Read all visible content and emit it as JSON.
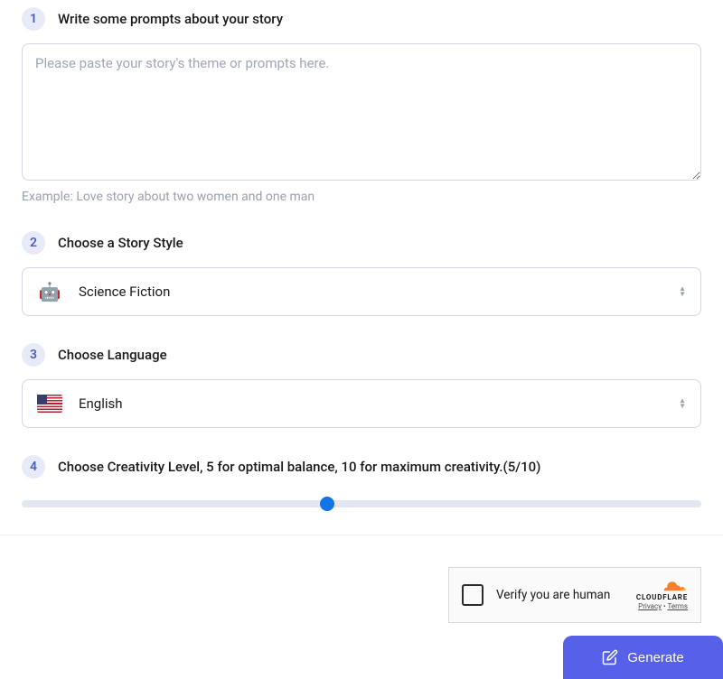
{
  "step1": {
    "number": "1",
    "title": "Write some prompts about your story",
    "placeholder": "Please paste your story's theme or prompts here.",
    "example_prefix": "Example:  ",
    "example_text": "Love story about two women and one man"
  },
  "step2": {
    "number": "2",
    "title": "Choose a Story Style",
    "selected": "Science Fiction",
    "icon": "🤖"
  },
  "step3": {
    "number": "3",
    "title": "Choose Language",
    "selected": "English"
  },
  "step4": {
    "number": "4",
    "title": "Choose Creativity Level, 5 for optimal balance, 10 for maximum creativity.(5/10)",
    "value": 5,
    "max": 10
  },
  "captcha": {
    "text": "Verify you are human",
    "brand": "CLOUDFLARE",
    "privacy": "Privacy",
    "terms": "Terms"
  },
  "generate": {
    "label": "Generate"
  }
}
